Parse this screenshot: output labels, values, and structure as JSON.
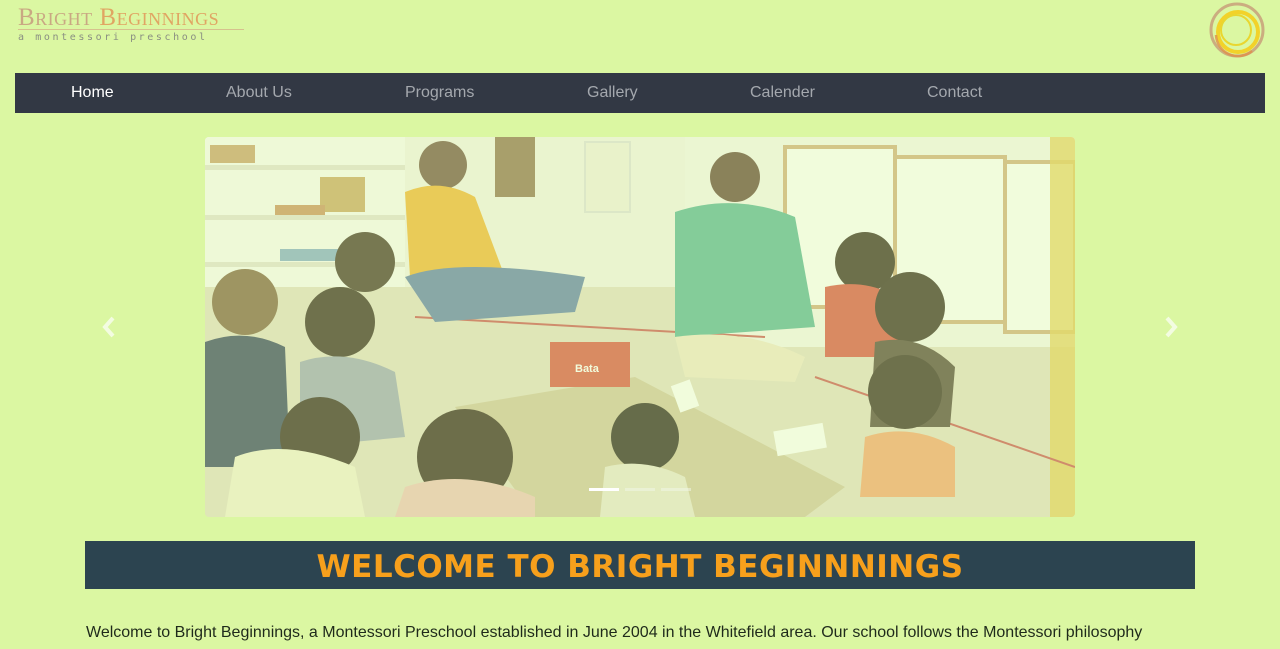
{
  "logo": {
    "title_part1": "Bright",
    "title_part2": "Beginnings",
    "subtitle": "a montessori preschool"
  },
  "nav": {
    "items": [
      {
        "label": "Home",
        "active": true
      },
      {
        "label": "About Us",
        "active": false
      },
      {
        "label": "Programs",
        "active": false
      },
      {
        "label": "Gallery",
        "active": false
      },
      {
        "label": "Calender",
        "active": false
      },
      {
        "label": "Contact",
        "active": false
      }
    ]
  },
  "carousel": {
    "prev_icon": "chevron-left-icon",
    "next_icon": "chevron-right-icon",
    "slide_count": 3,
    "active_slide": 1,
    "box_label": "Bata"
  },
  "welcome": {
    "title": "WELCOME TO BRIGHT BEGINNNINGS"
  },
  "intro": {
    "text": "Welcome to Bright Beginnings, a Montessori Preschool established in June 2004 in the Whitefield area. Our school follows the Montessori philosophy"
  },
  "colors": {
    "background": "#dbf7a2",
    "nav": "#323844",
    "banner": "#2c4450",
    "banner_text": "#f7a01c"
  }
}
